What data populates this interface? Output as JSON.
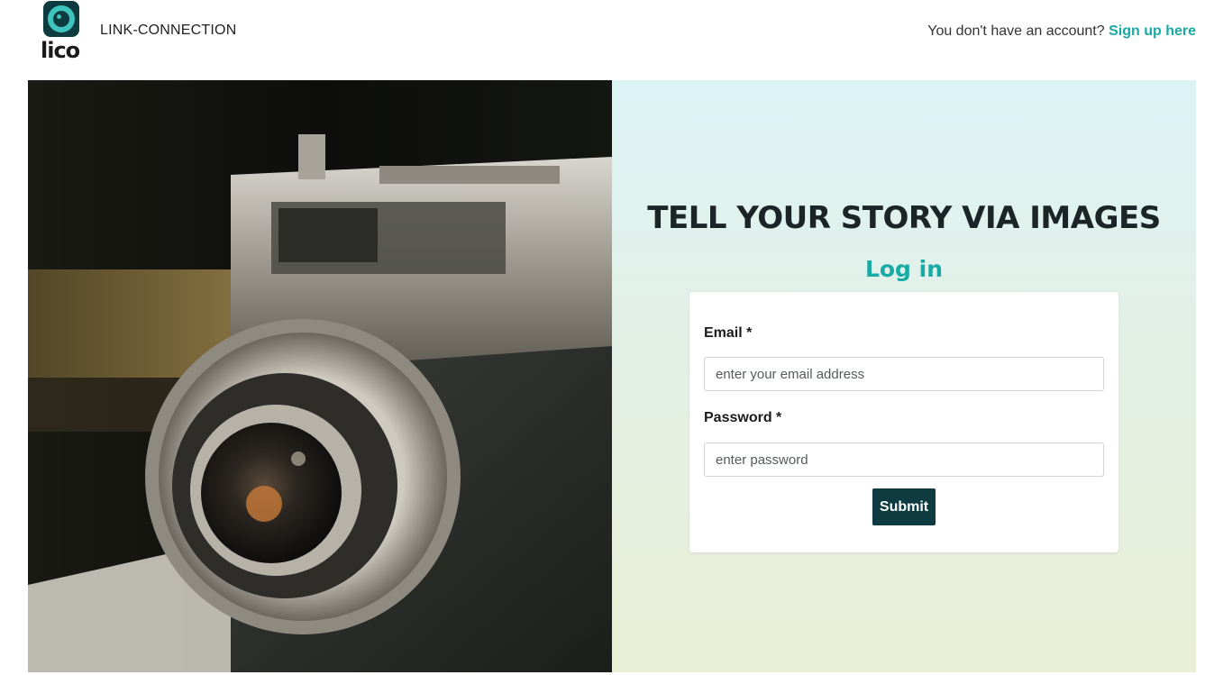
{
  "header": {
    "logo_text": "lico",
    "brand_name": "LINK-CONNECTION",
    "account_question": "You don't have an account?",
    "signup_link": "Sign up here"
  },
  "hero": {
    "tagline": "TELL YOUR STORY VIA IMAGES",
    "image_icon": "vintage-camera-photo"
  },
  "login": {
    "title": "Log in",
    "email_label": "Email *",
    "email_placeholder": "enter your email address",
    "password_label": "Password *",
    "password_placeholder": "enter password",
    "submit_label": "Submit"
  },
  "colors": {
    "accent": "#18aaa4",
    "dark": "#0d3b40",
    "panel_top": "#dcf3f6",
    "panel_bottom": "#eaf0d6"
  }
}
